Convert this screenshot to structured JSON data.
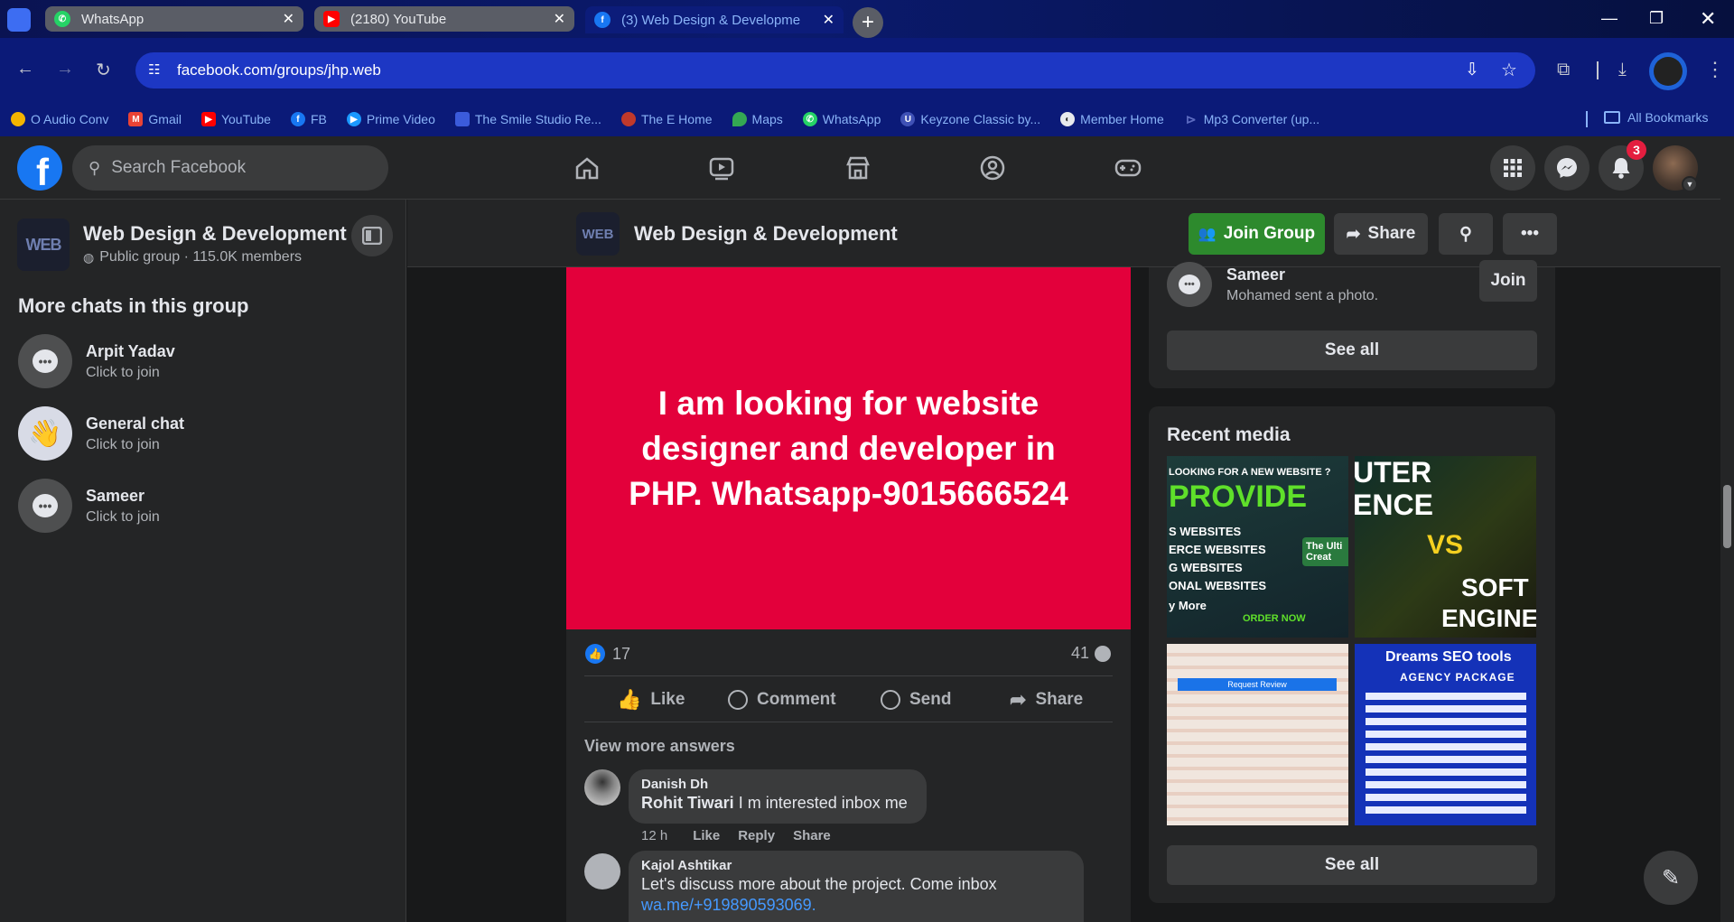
{
  "browser": {
    "tabs": [
      {
        "title": "WhatsApp",
        "icon": "whatsapp-icon",
        "active": false
      },
      {
        "title": "(2180) YouTube",
        "icon": "youtube-icon",
        "active": false
      },
      {
        "title": "(3) Web Design & Developme",
        "icon": "facebook-icon",
        "active": true
      }
    ],
    "url": "facebook.com/groups/jhp.web",
    "bookmarks": [
      {
        "label": "O Audio Conv",
        "color": "#f4b400"
      },
      {
        "label": "Gmail",
        "color": "#ea4335"
      },
      {
        "label": "YouTube",
        "color": "#ff0000"
      },
      {
        "label": "FB",
        "color": "#1877f2"
      },
      {
        "label": "Prime Video",
        "color": "#1a98ff"
      },
      {
        "label": "The Smile Studio Re...",
        "color": "#3b5bdb"
      },
      {
        "label": "The E Home",
        "color": "#c0392b"
      },
      {
        "label": "Maps",
        "color": "#34a853"
      },
      {
        "label": "WhatsApp",
        "color": "#25d366"
      },
      {
        "label": "Keyzone Classic by...",
        "color": "#3f51b5"
      },
      {
        "label": "Member Home",
        "color": "#9aa0a6"
      },
      {
        "label": "Mp3 Converter (up...",
        "color": "#5c6bc0"
      }
    ],
    "all_bookmarks": "All Bookmarks"
  },
  "facebook": {
    "logo": "f",
    "search_placeholder": "Search Facebook",
    "notification_count": "3"
  },
  "sidebar": {
    "group_logo_text": "WEB",
    "group_name": "Web Design & Development",
    "group_meta": "Public group · 115.0K members",
    "chats_heading": "More chats in this group",
    "chats": [
      {
        "name": "Arpit Yadav",
        "sub": "Click to join"
      },
      {
        "name": "General chat",
        "sub": "Click to join"
      },
      {
        "name": "Sameer",
        "sub": "Click to join"
      }
    ]
  },
  "groupbar": {
    "title": "Web Design & Development",
    "join_label": "Join Group",
    "share_label": "Share"
  },
  "post": {
    "image_text": "I am looking for website designer and developer in PHP. Whatsapp-9015666524",
    "like_count": "17",
    "comment_count": "41",
    "actions": {
      "like": "Like",
      "comment": "Comment",
      "send": "Send",
      "share": "Share"
    },
    "view_more": "View more answers",
    "comments": [
      {
        "author": "Danish Dh",
        "mention": "Rohit Tiwari",
        "text": "I m interested inbox me",
        "time": "12 h",
        "like": "Like",
        "reply": "Reply",
        "share": "Share"
      },
      {
        "author": "Kajol Ashtikar",
        "text": "Let's discuss more about the project. Come inbox",
        "link": "wa.me/+919890593069."
      }
    ]
  },
  "right": {
    "chat_name": "Sameer",
    "chat_sub": "Mohamed sent a photo.",
    "join_label": "Join",
    "see_all": "See all",
    "media_heading": "Recent media",
    "media": [
      {
        "line1": "LOOKING FOR A NEW WEBSITE ?",
        "line2": "PROVIDE",
        "line3": "S WEBSITES",
        "line4": "ERCE WEBSITES",
        "line5": "G WEBSITES",
        "line6": "ONAL WEBSITES",
        "line7": "y More",
        "line8": "ORDER NOW",
        "side": "The Ulti Creat"
      },
      {
        "line1": "UTER",
        "line2": "ENCE",
        "line3": "VS",
        "line4": "SOFT",
        "line5": "ENGINE"
      },
      {
        "line1": "Request Review"
      },
      {
        "line1": "Dreams SEO tools",
        "line2": "AGENCY PACKAGE"
      }
    ],
    "see_all_media": "See all"
  }
}
